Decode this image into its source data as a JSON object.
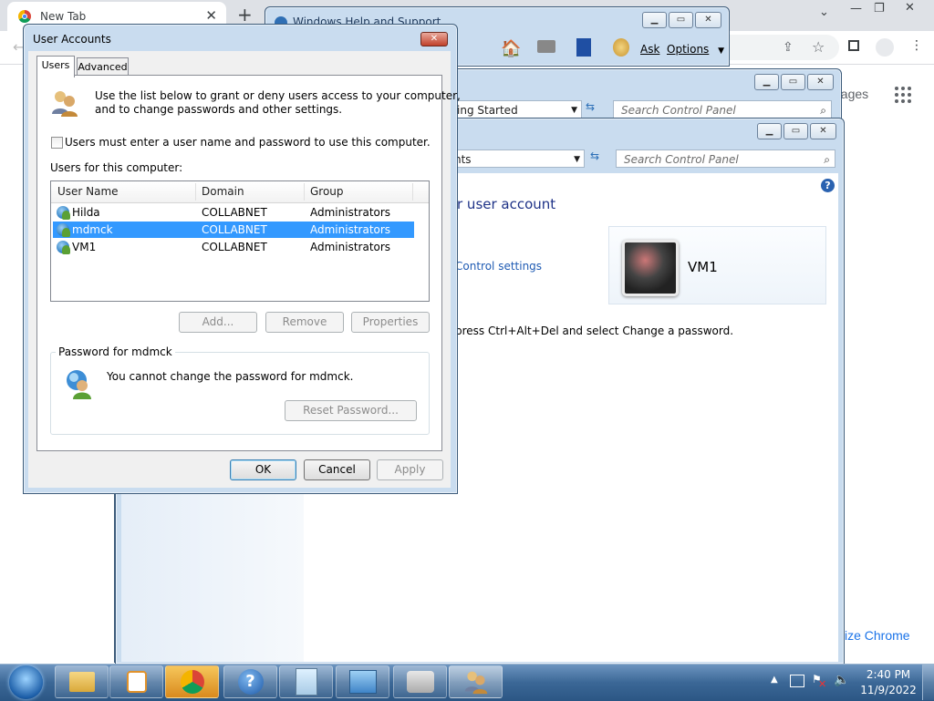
{
  "chrome": {
    "tab_title": "New Tab",
    "tab_close": "✕",
    "new_tab": "+",
    "right_text_images": "nages",
    "customize": "ize Chrome",
    "ctrl_min": "—",
    "ctrl_restore": "❐",
    "ctrl_close": "✕"
  },
  "help_window": {
    "title": "Windows Help and Support",
    "ask_label": "Ask",
    "options_label": "Options"
  },
  "cp_back": {
    "address": "ing Started",
    "search_placeholder": "Search Control Panel"
  },
  "cp_front": {
    "address": "nts",
    "search_placeholder": "Search Control Panel",
    "heading": "r user account",
    "link": "Control settings",
    "account_name": "VM1",
    "info_text": "press Ctrl+Alt+Del and select Change a password."
  },
  "user_accounts": {
    "title": "User Accounts",
    "tabs": [
      "Users",
      "Advanced"
    ],
    "intro_line1": "Use the list below to grant or deny users access to your computer,",
    "intro_line2": "and to change passwords and other settings.",
    "must_enter_label": "Users must enter a user name and password to use this computer.",
    "must_enter_checked": false,
    "users_label": "Users for this computer:",
    "columns": [
      "User Name",
      "Domain",
      "Group"
    ],
    "rows": [
      {
        "name": "Hilda",
        "domain": "COLLABNET",
        "group": "Administrators",
        "selected": false
      },
      {
        "name": "mdmck",
        "domain": "COLLABNET",
        "group": "Administrators",
        "selected": true
      },
      {
        "name": "VM1",
        "domain": "COLLABNET",
        "group": "Administrators",
        "selected": false
      }
    ],
    "add_label": "Add...",
    "remove_label": "Remove",
    "properties_label": "Properties",
    "password_group_label": "Password for mdmck",
    "password_text": "You cannot change the password for mdmck.",
    "reset_password_label": "Reset Password...",
    "ok_label": "OK",
    "cancel_label": "Cancel",
    "apply_label": "Apply"
  },
  "taskbar": {
    "time": "2:40 PM",
    "date": "11/9/2022"
  }
}
